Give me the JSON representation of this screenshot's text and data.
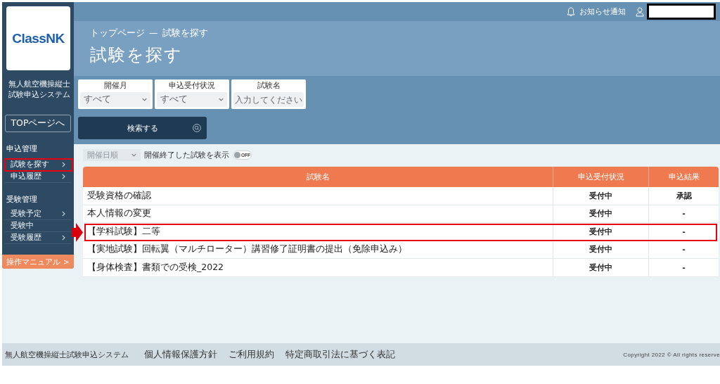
{
  "header": {
    "notification_label": "お知らせ通知"
  },
  "sidebar": {
    "logo_text": "ClassNK",
    "system_name": "無人航空機操縦士試験申込システム",
    "top_button": "TOPページへ",
    "sections": [
      {
        "heading": "申込管理",
        "items": [
          {
            "label": "試験を探す",
            "arrow": true,
            "highlighted": true
          },
          {
            "label": "申込履歴",
            "arrow": true,
            "highlighted": false
          }
        ]
      },
      {
        "heading": "受験管理",
        "items": [
          {
            "label": "受験予定",
            "arrow": true,
            "highlighted": false
          },
          {
            "label": "受験中",
            "arrow": false,
            "highlighted": false
          },
          {
            "label": "受験履歴",
            "arrow": true,
            "highlighted": false
          }
        ]
      }
    ],
    "manual_button": "操作マニュアル >"
  },
  "page": {
    "breadcrumb": {
      "items": [
        "トップページ",
        "試験を探す"
      ],
      "separator": "—"
    },
    "title": "試験を探す"
  },
  "filters": [
    {
      "kind": "select",
      "label": "開催月",
      "value": "すべて"
    },
    {
      "kind": "select",
      "label": "申込受付状況",
      "value": "すべて"
    },
    {
      "kind": "text",
      "label": "試験名",
      "placeholder": "入力してください"
    }
  ],
  "search_button": "検索する",
  "list_controls": {
    "sort": "開催日順",
    "toggle_label": "開催終了した試験を表示",
    "toggle_on": false,
    "toggle_text": "OFF"
  },
  "table": {
    "columns": [
      "試験名",
      "申込受付状況",
      "申込結果"
    ],
    "rows": [
      {
        "cells": [
          "受験資格の確認",
          "受付中",
          "承認"
        ],
        "highlighted": false
      },
      {
        "cells": [
          "本人情報の変更",
          "受付中",
          "-"
        ],
        "highlighted": false
      },
      {
        "cells": [
          "【学科試験】二等",
          "受付中",
          "-"
        ],
        "highlighted": true
      },
      {
        "cells": [
          "【実地試験】回転翼（マルチローター）講習修了証明書の提出（免除申込み）",
          "受付中",
          "-"
        ],
        "highlighted": false
      },
      {
        "cells": [
          "【身体検査】書類での受検_2022",
          "受付中",
          "-"
        ],
        "highlighted": false
      }
    ]
  },
  "footer": {
    "system_name": "無人航空機操縦士試験申込システム",
    "links": [
      "個人情報保護方針",
      "ご利用規約",
      "特定商取引法に基づく表記"
    ],
    "copyright": "Copyright 2022 © All rights reserve"
  }
}
